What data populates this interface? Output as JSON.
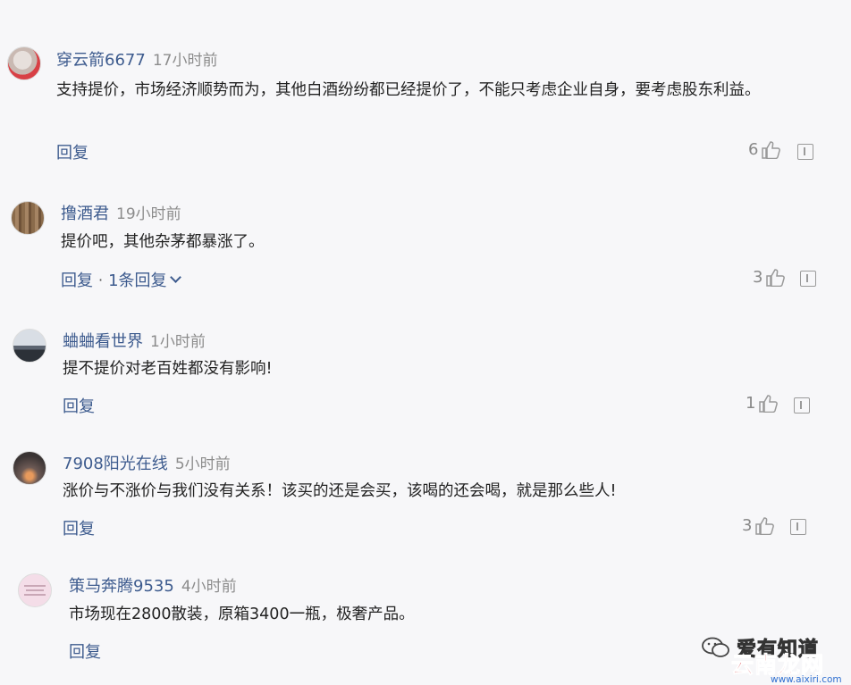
{
  "comments": [
    {
      "user": "穿云箭6677",
      "time": "17小时前",
      "text": "支持提价，市场经济顺势而为，其他白酒纷纷都已经提价了，不能只考虑企业自身，要考虑股东利益。",
      "reply": "回复",
      "likes": "6"
    },
    {
      "user": "撸酒君",
      "time": "19小时前",
      "text": "提价吧，其他杂茅都暴涨了。",
      "reply": "回复",
      "reply_count": "1条回复",
      "likes": "3"
    },
    {
      "user": "蛐蛐看世界",
      "time": "1小时前",
      "text": "提不提价对老百姓都没有影响!",
      "reply": "回复",
      "likes": "1"
    },
    {
      "user": "7908阳光在线",
      "time": "5小时前",
      "text": "涨价与不涨价与我们没有关系！该买的还是会买，该喝的还会喝，就是那么些人!",
      "reply": "回复",
      "likes": "3"
    },
    {
      "user": "策马奔腾9535",
      "time": "4小时前",
      "text": "市场现在2800散装，原箱3400一瓶，极奢产品。",
      "reply": "回复"
    }
  ],
  "watermark": {
    "account": "爱有知道",
    "brand": "云南龙网",
    "url": "www.aixiri.com"
  },
  "colors": {
    "username": "#3d5b8e",
    "background": "#f7f7f9",
    "brand_red": "#d3252a"
  }
}
